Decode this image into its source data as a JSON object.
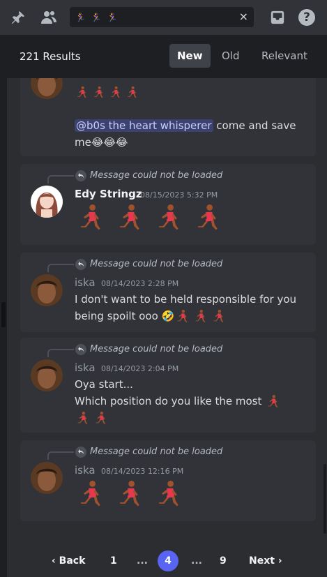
{
  "toolbar": {
    "pin_icon": "pin-icon",
    "members_icon": "members-icon",
    "search_query": "🏃‍♀️ 🏃‍♀️ 🏃‍♀️",
    "clear_label": "×",
    "inbox_icon": "inbox-icon",
    "help_label": "?"
  },
  "results": {
    "count": "221 Results",
    "sort_tabs": [
      {
        "label": "New",
        "active": true
      },
      {
        "label": "Old",
        "active": false
      },
      {
        "label": "Relevant",
        "active": false
      }
    ]
  },
  "messages": [
    {
      "partial": true,
      "body_prefix_runners": 4,
      "mention": "@b0s the heart whisperer",
      "text_after_mention": " come and save me",
      "trailing_emoji": "😂😂😂"
    },
    {
      "reply_text": "Message could not be loaded",
      "author": "Edy Stringz",
      "author_color": "#f2f3f5",
      "timestamp": "08/15/2023 5:32 PM",
      "runners": 4
    },
    {
      "reply_text": "Message could not be loaded",
      "author": "iska",
      "author_color": "#949ba4",
      "timestamp": "08/14/2023 2:28 PM",
      "text_line1": "I don't want to be held responsible for you",
      "text_line2": "being spoilt ooo",
      "trailing_emoji": "🤣",
      "runners": 3
    },
    {
      "reply_text": "Message could not be loaded",
      "author": "iska",
      "author_color": "#949ba4",
      "timestamp": "08/14/2023 2:04 PM",
      "text_line1": "Oya start...",
      "text_line2": "Which position do you like the most",
      "runners": 3
    },
    {
      "reply_text": "Message could not be loaded",
      "author": "iska",
      "author_color": "#949ba4",
      "timestamp": "08/14/2023 12:16 PM",
      "runners": 3
    }
  ],
  "pagination": {
    "back_label": "Back",
    "pages": [
      "1",
      "...",
      "4",
      "...",
      "9"
    ],
    "current": "4",
    "next_label": "Next"
  },
  "colors": {
    "accent": "#5865f2",
    "runner_shirt": "#e8384f",
    "runner_skin": "#a0522d"
  }
}
